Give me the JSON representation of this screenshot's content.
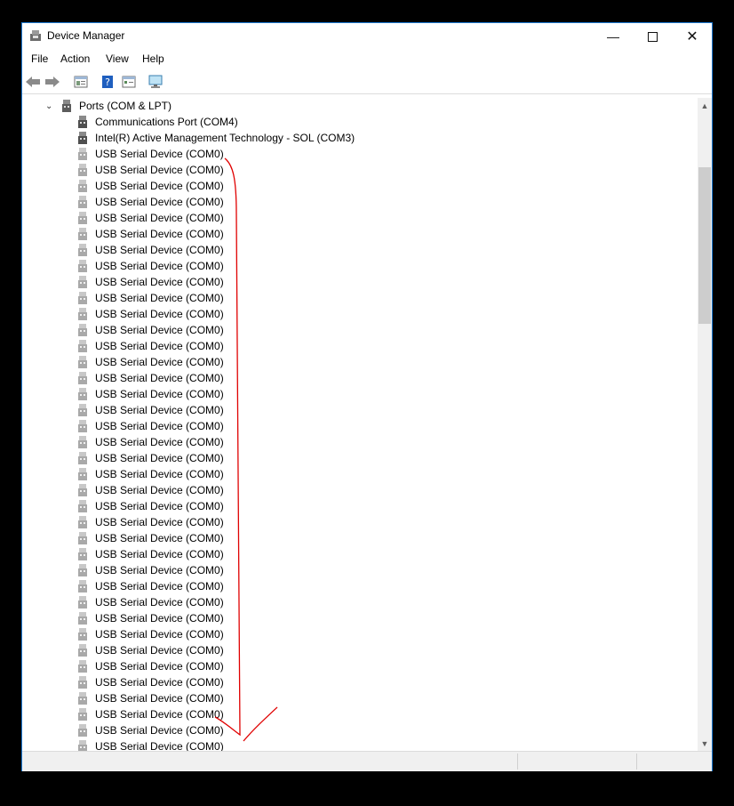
{
  "window": {
    "title": "Device Manager",
    "icons": {
      "app": "device-manager-icon"
    }
  },
  "menu": [
    "File",
    "Action",
    "View",
    "Help"
  ],
  "toolbar": [
    "back-arrow-icon",
    "forward-arrow-icon",
    "properties-icon",
    "help-icon",
    "show-hidden-icon",
    "monitor-icon"
  ],
  "tree": {
    "category": "Ports (COM & LPT)",
    "items": [
      "Communications Port (COM4)",
      "Intel(R) Active Management Technology - SOL (COM3)",
      "USB Serial Device (COM0)",
      "USB Serial Device (COM0)",
      "USB Serial Device (COM0)",
      "USB Serial Device (COM0)",
      "USB Serial Device (COM0)",
      "USB Serial Device (COM0)",
      "USB Serial Device (COM0)",
      "USB Serial Device (COM0)",
      "USB Serial Device (COM0)",
      "USB Serial Device (COM0)",
      "USB Serial Device (COM0)",
      "USB Serial Device (COM0)",
      "USB Serial Device (COM0)",
      "USB Serial Device (COM0)",
      "USB Serial Device (COM0)",
      "USB Serial Device (COM0)",
      "USB Serial Device (COM0)",
      "USB Serial Device (COM0)",
      "USB Serial Device (COM0)",
      "USB Serial Device (COM0)",
      "USB Serial Device (COM0)",
      "USB Serial Device (COM0)",
      "USB Serial Device (COM0)",
      "USB Serial Device (COM0)",
      "USB Serial Device (COM0)",
      "USB Serial Device (COM0)",
      "USB Serial Device (COM0)",
      "USB Serial Device (COM0)",
      "USB Serial Device (COM0)",
      "USB Serial Device (COM0)",
      "USB Serial Device (COM0)",
      "USB Serial Device (COM0)",
      "USB Serial Device (COM0)",
      "USB Serial Device (COM0)",
      "USB Serial Device (COM0)",
      "USB Serial Device (COM0)",
      "USB Serial Device (COM0)",
      "USB Serial Device (COM0)",
      "USB Serial Device (COM0)"
    ]
  },
  "colors": {
    "window_border": "#1e7ad3",
    "annotation": "#e00000"
  }
}
